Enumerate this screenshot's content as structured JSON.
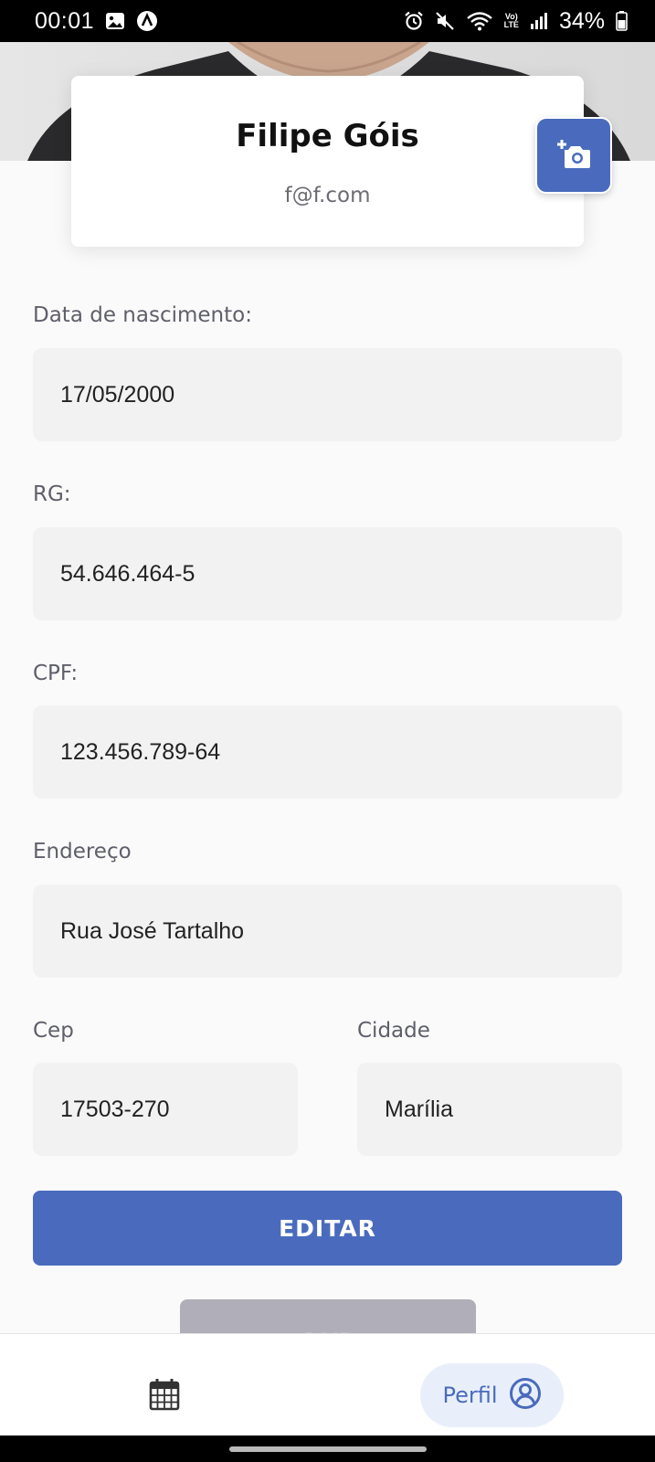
{
  "status_bar": {
    "time": "00:01",
    "battery_percent": "34%",
    "lte_top": "Vo)",
    "lte_bottom": "LTE",
    "icons": [
      "gallery-icon",
      "a-icon",
      "alarm-icon",
      "mute-icon",
      "wifi-icon",
      "lte-icon",
      "signal-icon",
      "battery-icon"
    ]
  },
  "profile": {
    "name": "Filipe Góis",
    "email": "f@f.com",
    "photo_button_icon": "add-photo-icon"
  },
  "form": {
    "birth_date": {
      "label": "Data de nascimento:",
      "value": "17/05/2000"
    },
    "rg": {
      "label": "RG:",
      "value": "54.646.464-5"
    },
    "cpf": {
      "label": "CPF:",
      "value": "123.456.789-64"
    },
    "address": {
      "label": "Endereço",
      "value": "Rua José Tartalho"
    },
    "cep": {
      "label": "Cep",
      "value": "17503-270"
    },
    "city": {
      "label": "Cidade",
      "value": "Marília"
    }
  },
  "actions": {
    "edit_label": "EDITAR",
    "exit_label": "SAIR"
  },
  "bottom_nav": {
    "items": [
      {
        "icon": "calendar-icon",
        "label": ""
      },
      {
        "icon": "user-circle-icon",
        "label": "Perfil"
      }
    ]
  },
  "colors": {
    "accent": "#4a6bbd",
    "field_bg": "#f3f2f3",
    "nav_active_bg": "#e9effa",
    "exit_bg": "#b0aeb9"
  }
}
